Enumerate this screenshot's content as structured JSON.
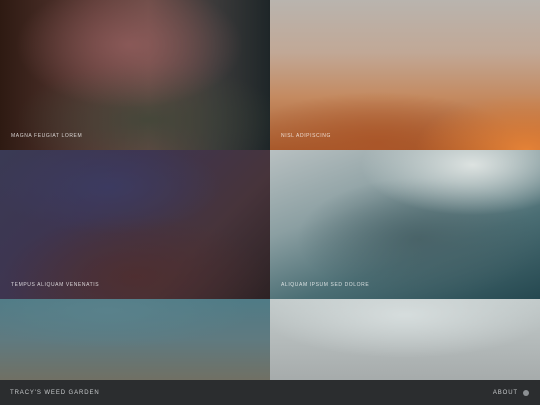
{
  "gallery": {
    "tiles": [
      {
        "caption": "MAGNA FEUGIAT LOREM"
      },
      {
        "caption": "NISL ADIPISCING"
      },
      {
        "caption": "TEMPUS ALIQUAM VENENATIS"
      },
      {
        "caption": "ALIQUAM IPSUM SED DOLORE"
      },
      {
        "caption": ""
      },
      {
        "caption": ""
      }
    ]
  },
  "footer": {
    "site_title": "TRACY'S WEED GARDEN",
    "about_label": "ABOUT",
    "about_icon": "circle-icon"
  }
}
